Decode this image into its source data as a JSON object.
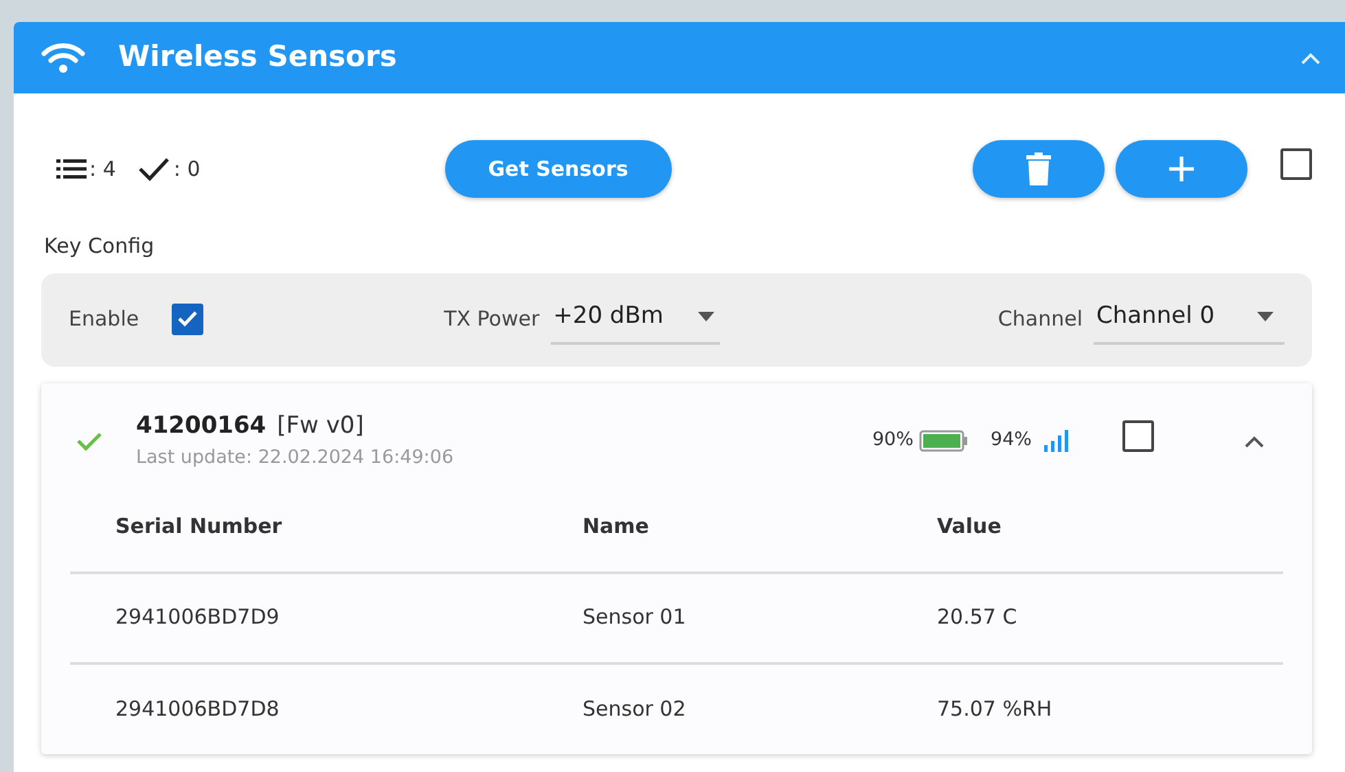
{
  "panel": {
    "title": "Wireless Sensors",
    "expanded": true
  },
  "toolbar": {
    "count_total": ": 4",
    "count_checked": ": 0",
    "get_button": "Get Sensors",
    "select_all": {
      "checked": false
    }
  },
  "key_config": {
    "label": "Key Config",
    "enable_label": "Enable",
    "enable": {
      "checked": true
    },
    "tx_power_label": "TX Power",
    "tx_power": "+20 dBm",
    "channel_label": "Channel",
    "channel": "Channel 0"
  },
  "devices": [
    {
      "ok": true,
      "id": "41200164",
      "firmware": "[Fw v0]",
      "last_update": "Last update: 22.02.2024 16:49:06",
      "battery": "90%",
      "signal": "94%",
      "checked": false,
      "expanded": true,
      "columns": [
        "Serial Number",
        "Name",
        "Value"
      ],
      "rows": [
        [
          "2941006BD7D9",
          "Sensor 01",
          "20.57 C"
        ],
        [
          "2941006BD7D8",
          "Sensor 02",
          "75.07 %RH"
        ]
      ]
    }
  ]
}
